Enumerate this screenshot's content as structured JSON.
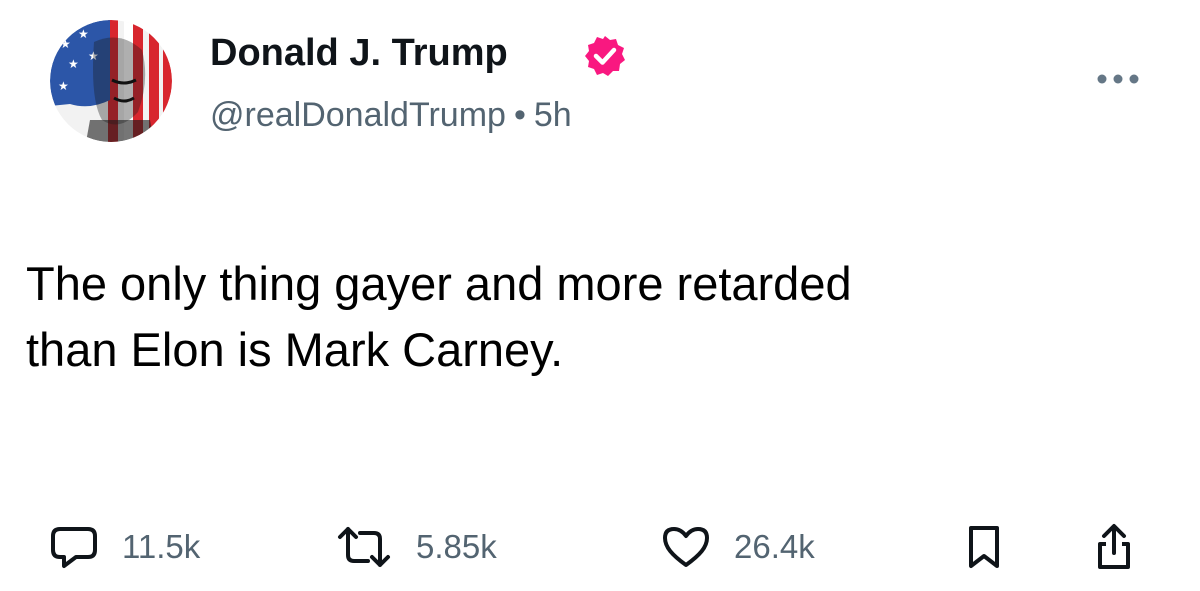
{
  "post": {
    "author_name": "Donald J. Trump",
    "handle": "@realDonaldTrump",
    "separator": "•",
    "time": "5h",
    "text_line1": "The only thing gayer and more retarded",
    "text_line2": "than Elon is Mark Carney.",
    "verified_color": "#f91880"
  },
  "actions": {
    "reply": {
      "icon": "reply-icon",
      "count": "11.5k"
    },
    "repost": {
      "icon": "repost-icon",
      "count": "5.85k"
    },
    "like": {
      "icon": "heart-icon",
      "count": "26.4k"
    },
    "bookmark": {
      "icon": "bookmark-icon"
    },
    "share": {
      "icon": "share-icon"
    }
  },
  "more_menu_icon": "more-horizontal-icon"
}
